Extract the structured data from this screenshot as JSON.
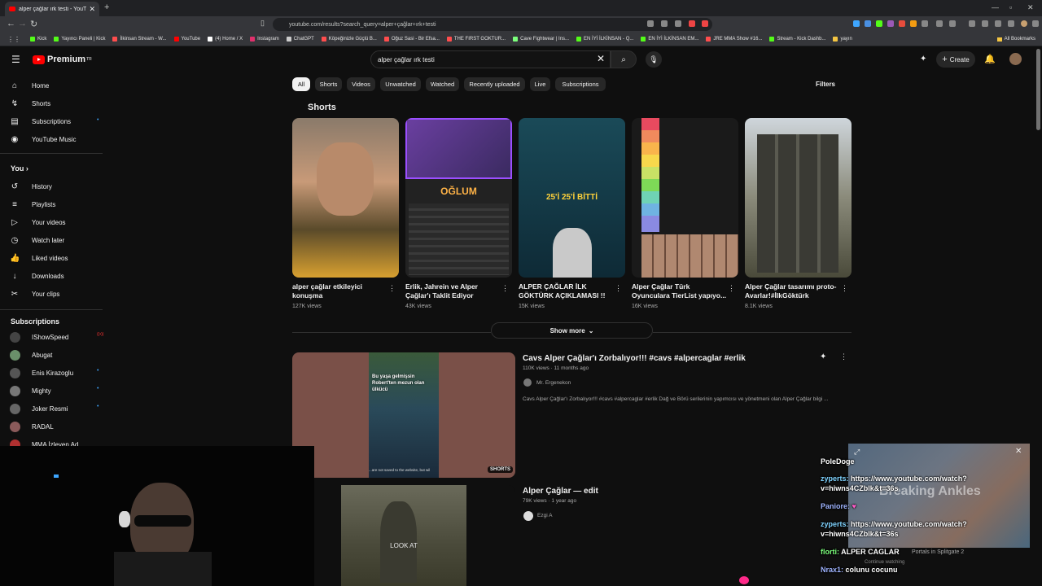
{
  "browser": {
    "tab_title": "alper çağlar ırk testi - YouTube",
    "url": "youtube.com/results?search_query=alper+çağlar+ırk+testi",
    "bookmarks": [
      {
        "label": "Kick",
        "color": "#53fc18"
      },
      {
        "label": "Yayıncı Paneli | Kick",
        "color": "#53fc18"
      },
      {
        "label": "İlkinsan Stream - W...",
        "color": "#ff4d4d"
      },
      {
        "label": "YouTube",
        "color": "#ff0000"
      },
      {
        "label": "(4) Home / X",
        "color": "#ffffff"
      },
      {
        "label": "Instagram",
        "color": "#e1306c"
      },
      {
        "label": "ChatGPT",
        "color": "#cccccc"
      },
      {
        "label": "Köpeğinizle Güçlü B...",
        "color": "#ff4d4d"
      },
      {
        "label": "Oğuz Sasi - Bir Efsa...",
        "color": "#ff4d4d"
      },
      {
        "label": "THE FIRST GOKTUR...",
        "color": "#ff4d4d"
      },
      {
        "label": "Cave Fightwear | Ins...",
        "color": "#7cff7c"
      },
      {
        "label": "EN İYİ İLKİNSAN - Q...",
        "color": "#53fc18"
      },
      {
        "label": "EN İYİ İLKİNSAN EM...",
        "color": "#53fc18"
      },
      {
        "label": "JRE MMA Show #16...",
        "color": "#ff4d4d"
      },
      {
        "label": "Stream - Kick Dashb...",
        "color": "#53fc18"
      },
      {
        "label": "yayın",
        "color": "#f4c542"
      }
    ],
    "all_bookmarks": "All Bookmarks"
  },
  "header": {
    "logo_text": "Premium",
    "logo_sup": "TR",
    "search_value": "alper çağlar ırk testi",
    "create_label": "Create"
  },
  "sidebar": {
    "main": [
      {
        "label": "Home",
        "icon": "⌂"
      },
      {
        "label": "Shorts",
        "icon": "↯"
      },
      {
        "label": "Subscriptions",
        "icon": "▤"
      },
      {
        "label": "YouTube Music",
        "icon": "◉"
      }
    ],
    "you_label": "You",
    "you_items": [
      {
        "label": "History",
        "icon": "↺"
      },
      {
        "label": "Playlists",
        "icon": "≡"
      },
      {
        "label": "Your videos",
        "icon": "▷"
      },
      {
        "label": "Watch later",
        "icon": "◷"
      },
      {
        "label": "Liked videos",
        "icon": "👍"
      },
      {
        "label": "Downloads",
        "icon": "↓"
      },
      {
        "label": "Your clips",
        "icon": "✂"
      }
    ],
    "subs_label": "Subscriptions",
    "subscriptions": [
      {
        "label": "IShowSpeed",
        "color": "#444"
      },
      {
        "label": "Abugat",
        "color": "#6a8f6a"
      },
      {
        "label": "Enis Kirazoglu",
        "color": "#555"
      },
      {
        "label": "Mighty",
        "color": "#777"
      },
      {
        "label": "Joker Resmi",
        "color": "#666"
      },
      {
        "label": "RADAL",
        "color": "#8a5a5a"
      },
      {
        "label": "MMA İzleyen Ad...",
        "color": "#b03030"
      }
    ]
  },
  "filters": {
    "chips": [
      "All",
      "Shorts",
      "Videos",
      "Unwatched",
      "Watched",
      "Recently uploaded",
      "Live",
      "Subscriptions"
    ],
    "filters_label": "Filters"
  },
  "shorts_section": {
    "heading": "Shorts",
    "items": [
      {
        "title": "alper çağlar etkileyici konuşma",
        "views": "127K views"
      },
      {
        "title": "Erlik, Jahrein ve Alper Çağlar'ı Taklit Ediyor",
        "views": "43K views",
        "overlay": "OĞLUM"
      },
      {
        "title": "ALPER ÇAĞLAR İLK GÖKTÜRK AÇIKLAMASI !!",
        "views": "15K views",
        "overlay": "25'İ 25'İ BİTTİ"
      },
      {
        "title": "Alper Çağlar Türk Oyunculara TierList yapıyo...",
        "views": "16K views"
      },
      {
        "title": "Alper Çağlar tasarımı proto-Avarlar!#İlkGöktürk",
        "views": "8.1K views"
      }
    ],
    "show_more": "Show more"
  },
  "videos": [
    {
      "title": "Cavs Alper Çağlar'ı Zorbalıyor!!! #cavs #alpercaglar #erlik",
      "meta": "110K views · 11 months ago",
      "channel": "Mr. Ergenekon",
      "desc": "Cavs Alper Çağlar'ı Zorbalıyor!!! #cavs #alpercaglar #erlik Dağ ve Börü serilerinin yapımcısı ve yönetmeni olan Alper Çağlar bilgi ...",
      "badge": "SHORTS",
      "thumb_caption_1": "Bu yaşa gelmişsin Robert'ten mezun olan ülkücü",
      "thumb_caption_2": "...are not saved to the website, but wil"
    },
    {
      "title": "Alper Çağlar — edit",
      "meta": "79K views · 1 year ago",
      "channel": "Ezgi A",
      "thumb_caption": "LOOK AT"
    }
  ],
  "chat": {
    "streamer": "PoleDoge",
    "messages": [
      {
        "user": "zyperts:",
        "text": "https://www.youtube.com/watch?v=hiwns4CZblk&t=36s",
        "color": "cyan"
      },
      {
        "user": "Paniore:",
        "text": "",
        "color": "blue"
      },
      {
        "user": "zyperts:",
        "text": "https://www.youtube.com/watch?v=hiwns4CZblk&t=36s",
        "color": "cyan"
      },
      {
        "user": "florti:",
        "text": "ALPER CAGLAR",
        "color": "green"
      },
      {
        "user": "Nrax1:",
        "text": "colunu cocunu",
        "color": "blue"
      }
    ],
    "bg_text_1": "Breaking Ankles",
    "bg_text_2": "Portals in Splitgate 2",
    "bg_text_3": "Continue watching"
  }
}
